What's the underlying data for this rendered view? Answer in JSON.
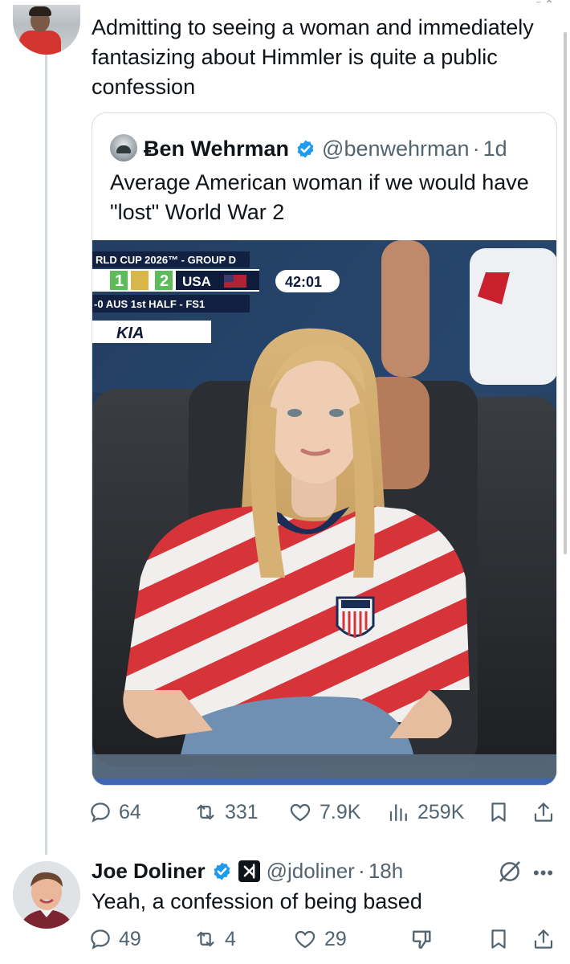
{
  "main_tweet": {
    "text": "Admitting to seeing a woman and immediately fantasizing about Himmler is quite a public confession"
  },
  "quoted_tweet": {
    "name": "Ƀen Wehrman",
    "handle": "@benwehrman",
    "separator": "·",
    "time": "1d",
    "text": "Average American woman if we would have \"lost\" World War 2",
    "scoreboard": {
      "banner": "RLD CUP 2026™ - GROUP D",
      "score_home": "1",
      "score_away": "2",
      "team": "USA",
      "clock": "42:01",
      "sub": "-0 AUS  1st HALF - FS1",
      "sponsor": "KIA",
      "crest": "USA"
    }
  },
  "main_actions": {
    "replies": "64",
    "reposts": "331",
    "likes": "7.9K",
    "views": "259K"
  },
  "reply": {
    "name": "Joe Doliner",
    "handle": "@jdoliner",
    "separator": "·",
    "time": "18h",
    "text": "Yeah, a confession of being based",
    "actions": {
      "replies": "49",
      "reposts": "4",
      "likes": "29"
    }
  },
  "colors": {
    "text": "#0f1419",
    "secondary": "#536471",
    "verified": "#1d9bf0",
    "border": "#cfd9de"
  }
}
